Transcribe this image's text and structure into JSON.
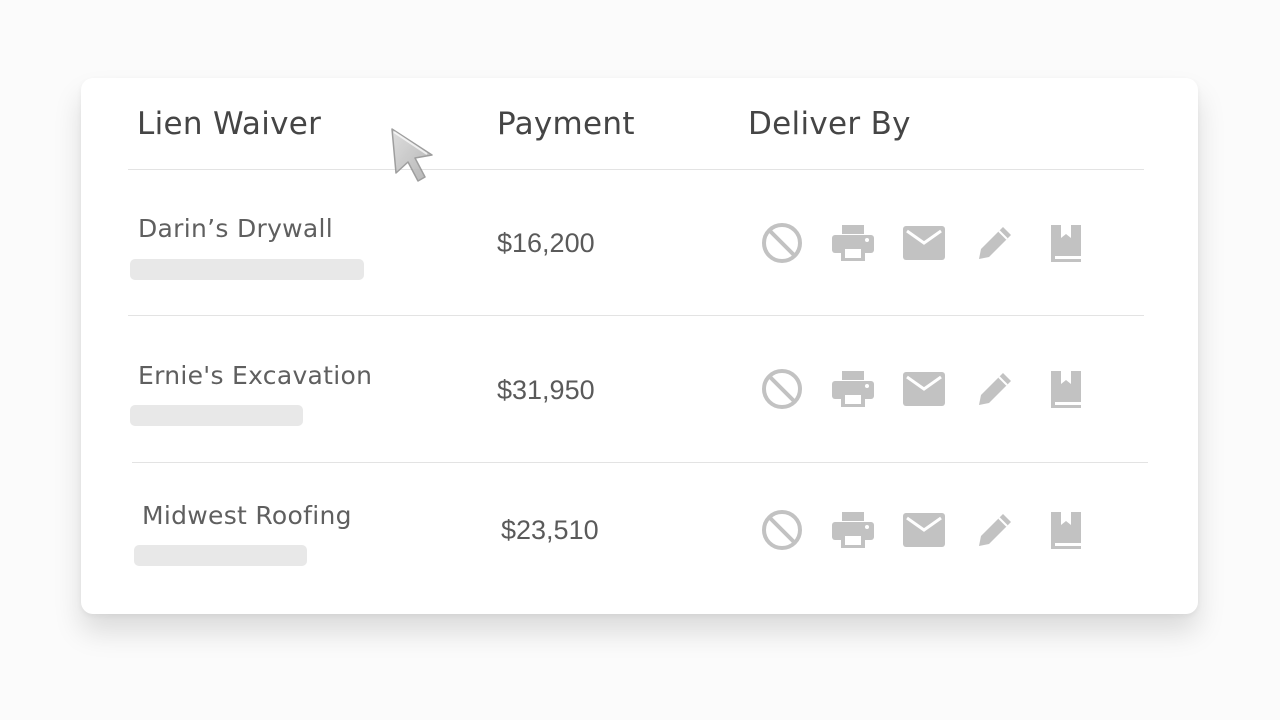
{
  "table": {
    "headers": {
      "lien_waiver": "Lien Waiver",
      "payment": "Payment",
      "deliver_by": "Deliver By"
    },
    "rows": [
      {
        "vendor": "Darin’s Drywall",
        "payment": "$16,200"
      },
      {
        "vendor": "Ernie's Excavation",
        "payment": "$31,950"
      },
      {
        "vendor": "Midwest Roofing",
        "payment": "$23,510"
      }
    ],
    "delivery_icons": [
      "block-icon",
      "print-icon",
      "email-icon",
      "edit-icon",
      "book-icon"
    ]
  },
  "colors": {
    "icon": "#c2c2c2",
    "header_text": "#454545",
    "row_text": "#5f5f5f",
    "skeleton": "#e8e8e8"
  }
}
